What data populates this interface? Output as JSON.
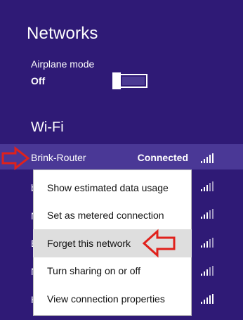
{
  "colors": {
    "background": "#2f1a76",
    "selected_row": "#4a3896",
    "menu_background": "#ffffff",
    "menu_selected": "#dedede",
    "annotation_arrow": "#e0211c"
  },
  "header": {
    "title": "Networks"
  },
  "airplane_mode": {
    "label": "Airplane mode",
    "state": "Off",
    "toggle_on": false
  },
  "wifi": {
    "section_title": "Wi-Fi",
    "networks": [
      {
        "label": "Brink-Router",
        "status": "Connected",
        "signal_icon": "wifi-signal-full-icon",
        "selected": true
      },
      {
        "label": "b",
        "signal_icon": "wifi-signal-icon"
      },
      {
        "label": "N",
        "signal_icon": "wifi-signal-icon"
      },
      {
        "label": "E",
        "signal_icon": "wifi-signal-icon"
      },
      {
        "label": "N",
        "signal_icon": "wifi-signal-icon"
      },
      {
        "label": "H",
        "signal_icon": "wifi-signal-full-icon"
      }
    ]
  },
  "context_menu": {
    "items": [
      {
        "label": "Show estimated data usage"
      },
      {
        "label": "Set as metered connection"
      },
      {
        "label": "Forget this network",
        "selected": true
      },
      {
        "label": "Turn sharing on or off"
      },
      {
        "label": "View connection properties"
      }
    ]
  }
}
